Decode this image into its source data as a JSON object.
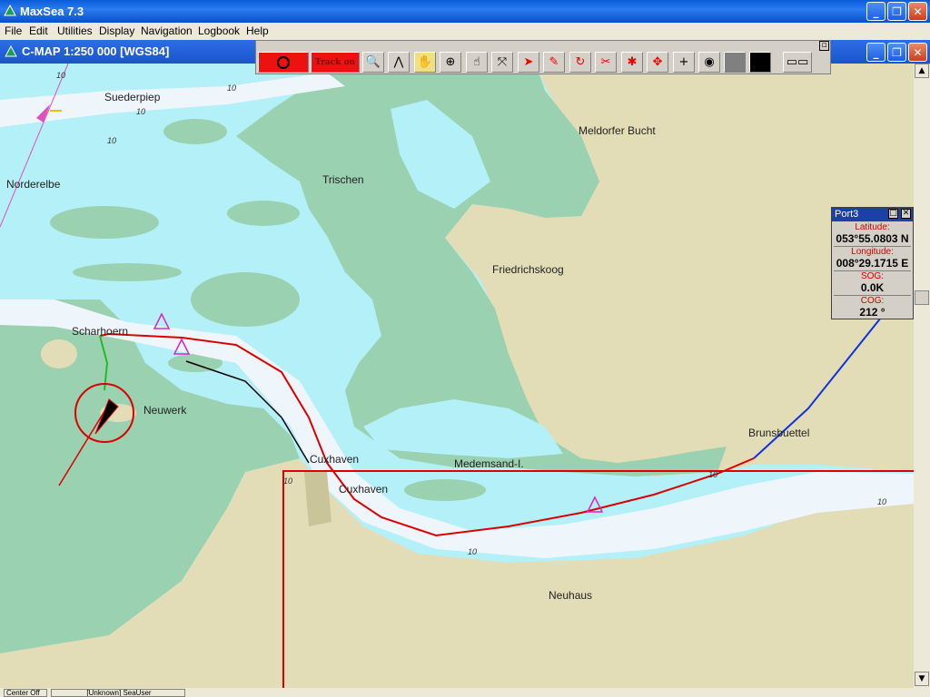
{
  "app": {
    "title": "MaxSea 7.3"
  },
  "menu": {
    "items": [
      "File",
      "Edit",
      "Utilities",
      "Display",
      "Navigation",
      "Logbook",
      "Help"
    ]
  },
  "chart_window": {
    "title": "C-MAP  1:250 000 [WGS84]"
  },
  "toolbar": {
    "track_label": "Track on",
    "icons": [
      "stop-record",
      "track-on",
      "zoom",
      "compass-dividers",
      "pan-hand",
      "center-crosshair",
      "hand-select",
      "zoom-fit",
      "pointer",
      "pencil",
      "rotate",
      "scissors",
      "route-edit",
      "move-cross",
      "plus",
      "target-circle",
      "monitor-toggle"
    ]
  },
  "map": {
    "places": {
      "suederpiep": "Suederpiep",
      "meldorfer": "Meldorfer Bucht",
      "norderelbe": "Norderelbe",
      "trischen": "Trischen",
      "friedrichskoog": "Friedrichskoog",
      "scharhoern": "Scharhoern",
      "neuwerk": "Neuwerk",
      "cuxhaven1": "Cuxhaven",
      "cuxhaven2": "Cuxhaven",
      "medemsand": "Medemsand-I.",
      "brunsbuettel": "Brunsbuettel",
      "neuhaus": "Neuhaus"
    },
    "depth_label": "10",
    "colors": {
      "shallow": "#b3f0f8",
      "deep": "#eef6fb",
      "tidal": "#99d1b1",
      "land": "#e2ddb6",
      "track": "#dd0000",
      "route": "#1030e0"
    }
  },
  "port_panel": {
    "title": "Port3",
    "latitude_label": "Latitude:",
    "latitude_value": "053°55.0803 N",
    "longitude_label": "Longitude:",
    "longitude_value": "008°29.1715 E",
    "sog_label": "SOG:",
    "sog_value": "0.0K",
    "cog_label": "COG:",
    "cog_value": "212 °"
  },
  "status": {
    "left": "Center Off",
    "user": "[Unknown] SeaUser"
  }
}
